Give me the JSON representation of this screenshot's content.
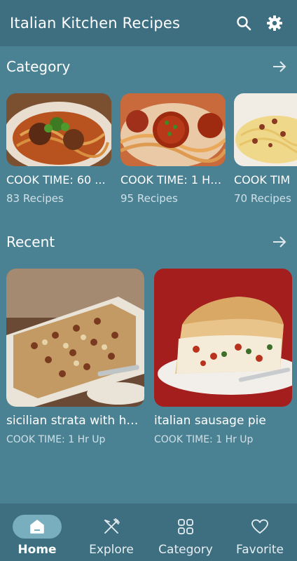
{
  "app": {
    "title": "Italian Kitchen Recipes",
    "search_icon": "search-icon",
    "settings_icon": "gear-icon"
  },
  "category_section": {
    "title": "Category",
    "arrow_icon": "arrow-right-icon",
    "items": [
      {
        "name": "COOK TIME: 60 ...",
        "count": "83 Recipes"
      },
      {
        "name": "COOK TIME: 1 Hr ...",
        "count": "95 Recipes"
      },
      {
        "name": "COOK TIM",
        "count": "70 Recipes"
      }
    ]
  },
  "recent_section": {
    "title": "Recent",
    "arrow_icon": "arrow-right-icon",
    "items": [
      {
        "name": "sicilian strata with ho...",
        "time": "COOK TIME: 1 Hr Up"
      },
      {
        "name": "italian sausage pie",
        "time": "COOK TIME: 1 Hr Up"
      }
    ]
  },
  "nav": {
    "items": [
      {
        "label": "Home",
        "icon": "home-icon",
        "active": true
      },
      {
        "label": "Explore",
        "icon": "utensils-icon",
        "active": false
      },
      {
        "label": "Category",
        "icon": "grid-icon",
        "active": false
      },
      {
        "label": "Favorite",
        "icon": "heart-icon",
        "active": false
      }
    ]
  },
  "colors": {
    "background": "#4a8294",
    "bar": "#3e6f81",
    "active_pill": "#78aebe",
    "secondary_text": "#cfe0e6"
  }
}
